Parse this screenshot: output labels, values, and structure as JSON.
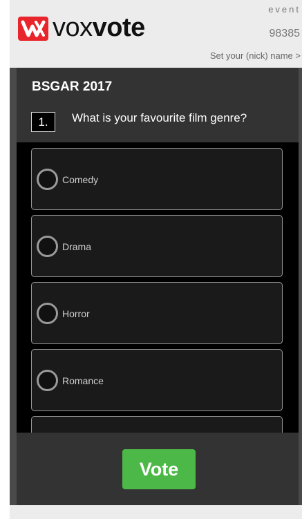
{
  "header": {
    "logo_plain": "vox",
    "logo_bold": "vote",
    "event_label": "event",
    "event_code": "98385",
    "nick_link": "Set your (nick) name >"
  },
  "poll": {
    "title": "BSGAR 2017",
    "question_number": "1.",
    "question": "What is your favourite film genre?",
    "options": [
      {
        "label": "Comedy"
      },
      {
        "label": "Drama"
      },
      {
        "label": "Horror"
      },
      {
        "label": "Romance"
      },
      {
        "label": ""
      }
    ]
  },
  "footer": {
    "vote_label": "Vote"
  },
  "colors": {
    "brand_red": "#e8252b",
    "vote_green": "#4cb848",
    "panel_dark": "#333333"
  }
}
